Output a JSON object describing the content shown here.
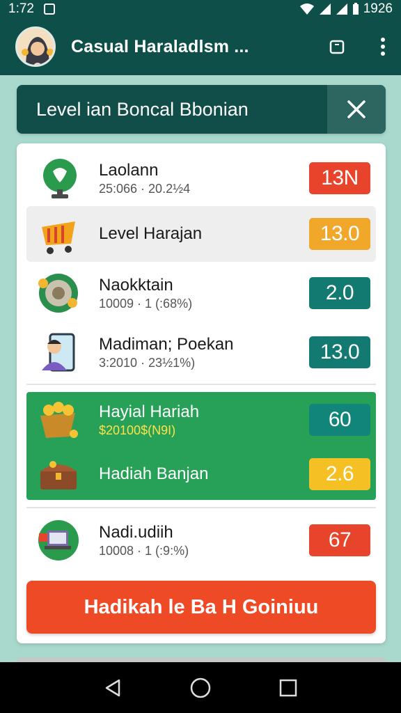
{
  "status_bar": {
    "time": "1:72",
    "right_text": "1926"
  },
  "app_bar": {
    "title": "Casual Haraladlsm ..."
  },
  "banner": {
    "title": "Level ian Boncal Bbonian"
  },
  "rows": [
    {
      "label": "Laolann",
      "sub": "25:066 · 20.2½4",
      "badge": "13N",
      "badge_color": "#e8432b",
      "icon": "heart-trophy-icon"
    },
    {
      "label": "Level Harajan",
      "sub": "",
      "badge": "13.0",
      "badge_color": "#f1a72a",
      "icon": "shopping-cart-icon"
    },
    {
      "label": "Naokktain",
      "sub": "10009 · 1 (:68%)",
      "badge": "2.0",
      "badge_color": "#127a70",
      "icon": "coin-wheel-icon"
    },
    {
      "label": "Madiman; Poekan",
      "sub": "3:2010 · 23½1%)",
      "badge": "13.0",
      "badge_color": "#127a70",
      "icon": "person-device-icon"
    }
  ],
  "green_rows": [
    {
      "label": "Hayial Hariah",
      "sub": "$20100$(N9I)",
      "badge": "60",
      "badge_color": "#12857a",
      "icon": "coin-basket-icon"
    },
    {
      "label": "Hadiah Banjan",
      "sub": "",
      "badge": "2.6",
      "badge_color": "#f4c023",
      "icon": "treasure-chest-icon"
    }
  ],
  "last_row": {
    "label": "Nadi.udiih",
    "sub": "10008 · 1 (:9:%)",
    "badge": "67",
    "badge_color": "#e8432b",
    "icon": "laptop-gift-icon"
  },
  "cta": {
    "label": "Hadikah le Ba H Goiniuu"
  },
  "colors": {
    "primary_dark": "#0f4f4a",
    "accent_red": "#ef4a26",
    "green": "#27a158",
    "background": "#a9d9cd"
  }
}
